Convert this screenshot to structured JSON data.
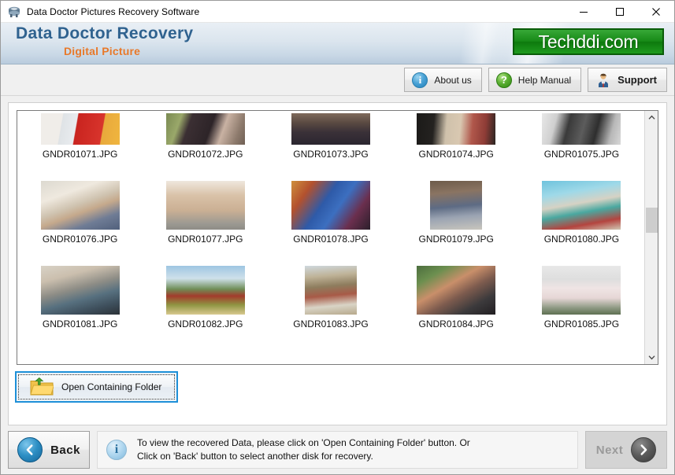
{
  "window": {
    "title": "Data Doctor Pictures Recovery Software",
    "icon": "app-icon",
    "controls": {
      "minimize": "minimize-icon",
      "maximize": "maximize-icon",
      "close": "close-icon"
    }
  },
  "brand": {
    "title": "Data Doctor Recovery",
    "subtitle": "Digital Picture",
    "logo_text": "Techddi.com",
    "title_color": "#2f628f",
    "subtitle_color": "#e8792a",
    "logo_bg": "#178a17"
  },
  "toolbar": {
    "buttons": [
      {
        "label": "About us",
        "icon": "info-icon",
        "glyph": "i"
      },
      {
        "label": "Help Manual",
        "icon": "question-icon",
        "glyph": "?"
      },
      {
        "label": "Support",
        "icon": "support-person-icon",
        "glyph": ""
      }
    ]
  },
  "grid": {
    "files": [
      {
        "name": "GNDR01071.JPG",
        "clipped": true
      },
      {
        "name": "GNDR01072.JPG",
        "clipped": true
      },
      {
        "name": "GNDR01073.JPG",
        "clipped": true
      },
      {
        "name": "GNDR01074.JPG",
        "clipped": true
      },
      {
        "name": "GNDR01075.JPG",
        "clipped": true
      },
      {
        "name": "GNDR01076.JPG",
        "clipped": false
      },
      {
        "name": "GNDR01077.JPG",
        "clipped": false
      },
      {
        "name": "GNDR01078.JPG",
        "clipped": false
      },
      {
        "name": "GNDR01079.JPG",
        "clipped": false
      },
      {
        "name": "GNDR01080.JPG",
        "clipped": false
      },
      {
        "name": "GNDR01081.JPG",
        "clipped": false
      },
      {
        "name": "GNDR01082.JPG",
        "clipped": false
      },
      {
        "name": "GNDR01083.JPG",
        "clipped": false
      },
      {
        "name": "GNDR01084.JPG",
        "clipped": false
      },
      {
        "name": "GNDR01085.JPG",
        "clipped": false
      }
    ],
    "scrollbar": {
      "up": "chevron-up-icon",
      "down": "chevron-down-icon"
    }
  },
  "open_folder": {
    "label": "Open Containing Folder",
    "icon": "folder-upload-icon",
    "focus_color": "#1e90d8"
  },
  "bottom": {
    "back_label": "Back",
    "back_icon": "chevron-left-icon",
    "next_label": "Next",
    "next_icon": "chevron-right-icon",
    "next_disabled": true,
    "info_icon": "info-icon",
    "message_line1": "To view the recovered Data, please click on 'Open Containing Folder' button. Or",
    "message_line2": "Click on 'Back' button to select another disk for recovery."
  }
}
